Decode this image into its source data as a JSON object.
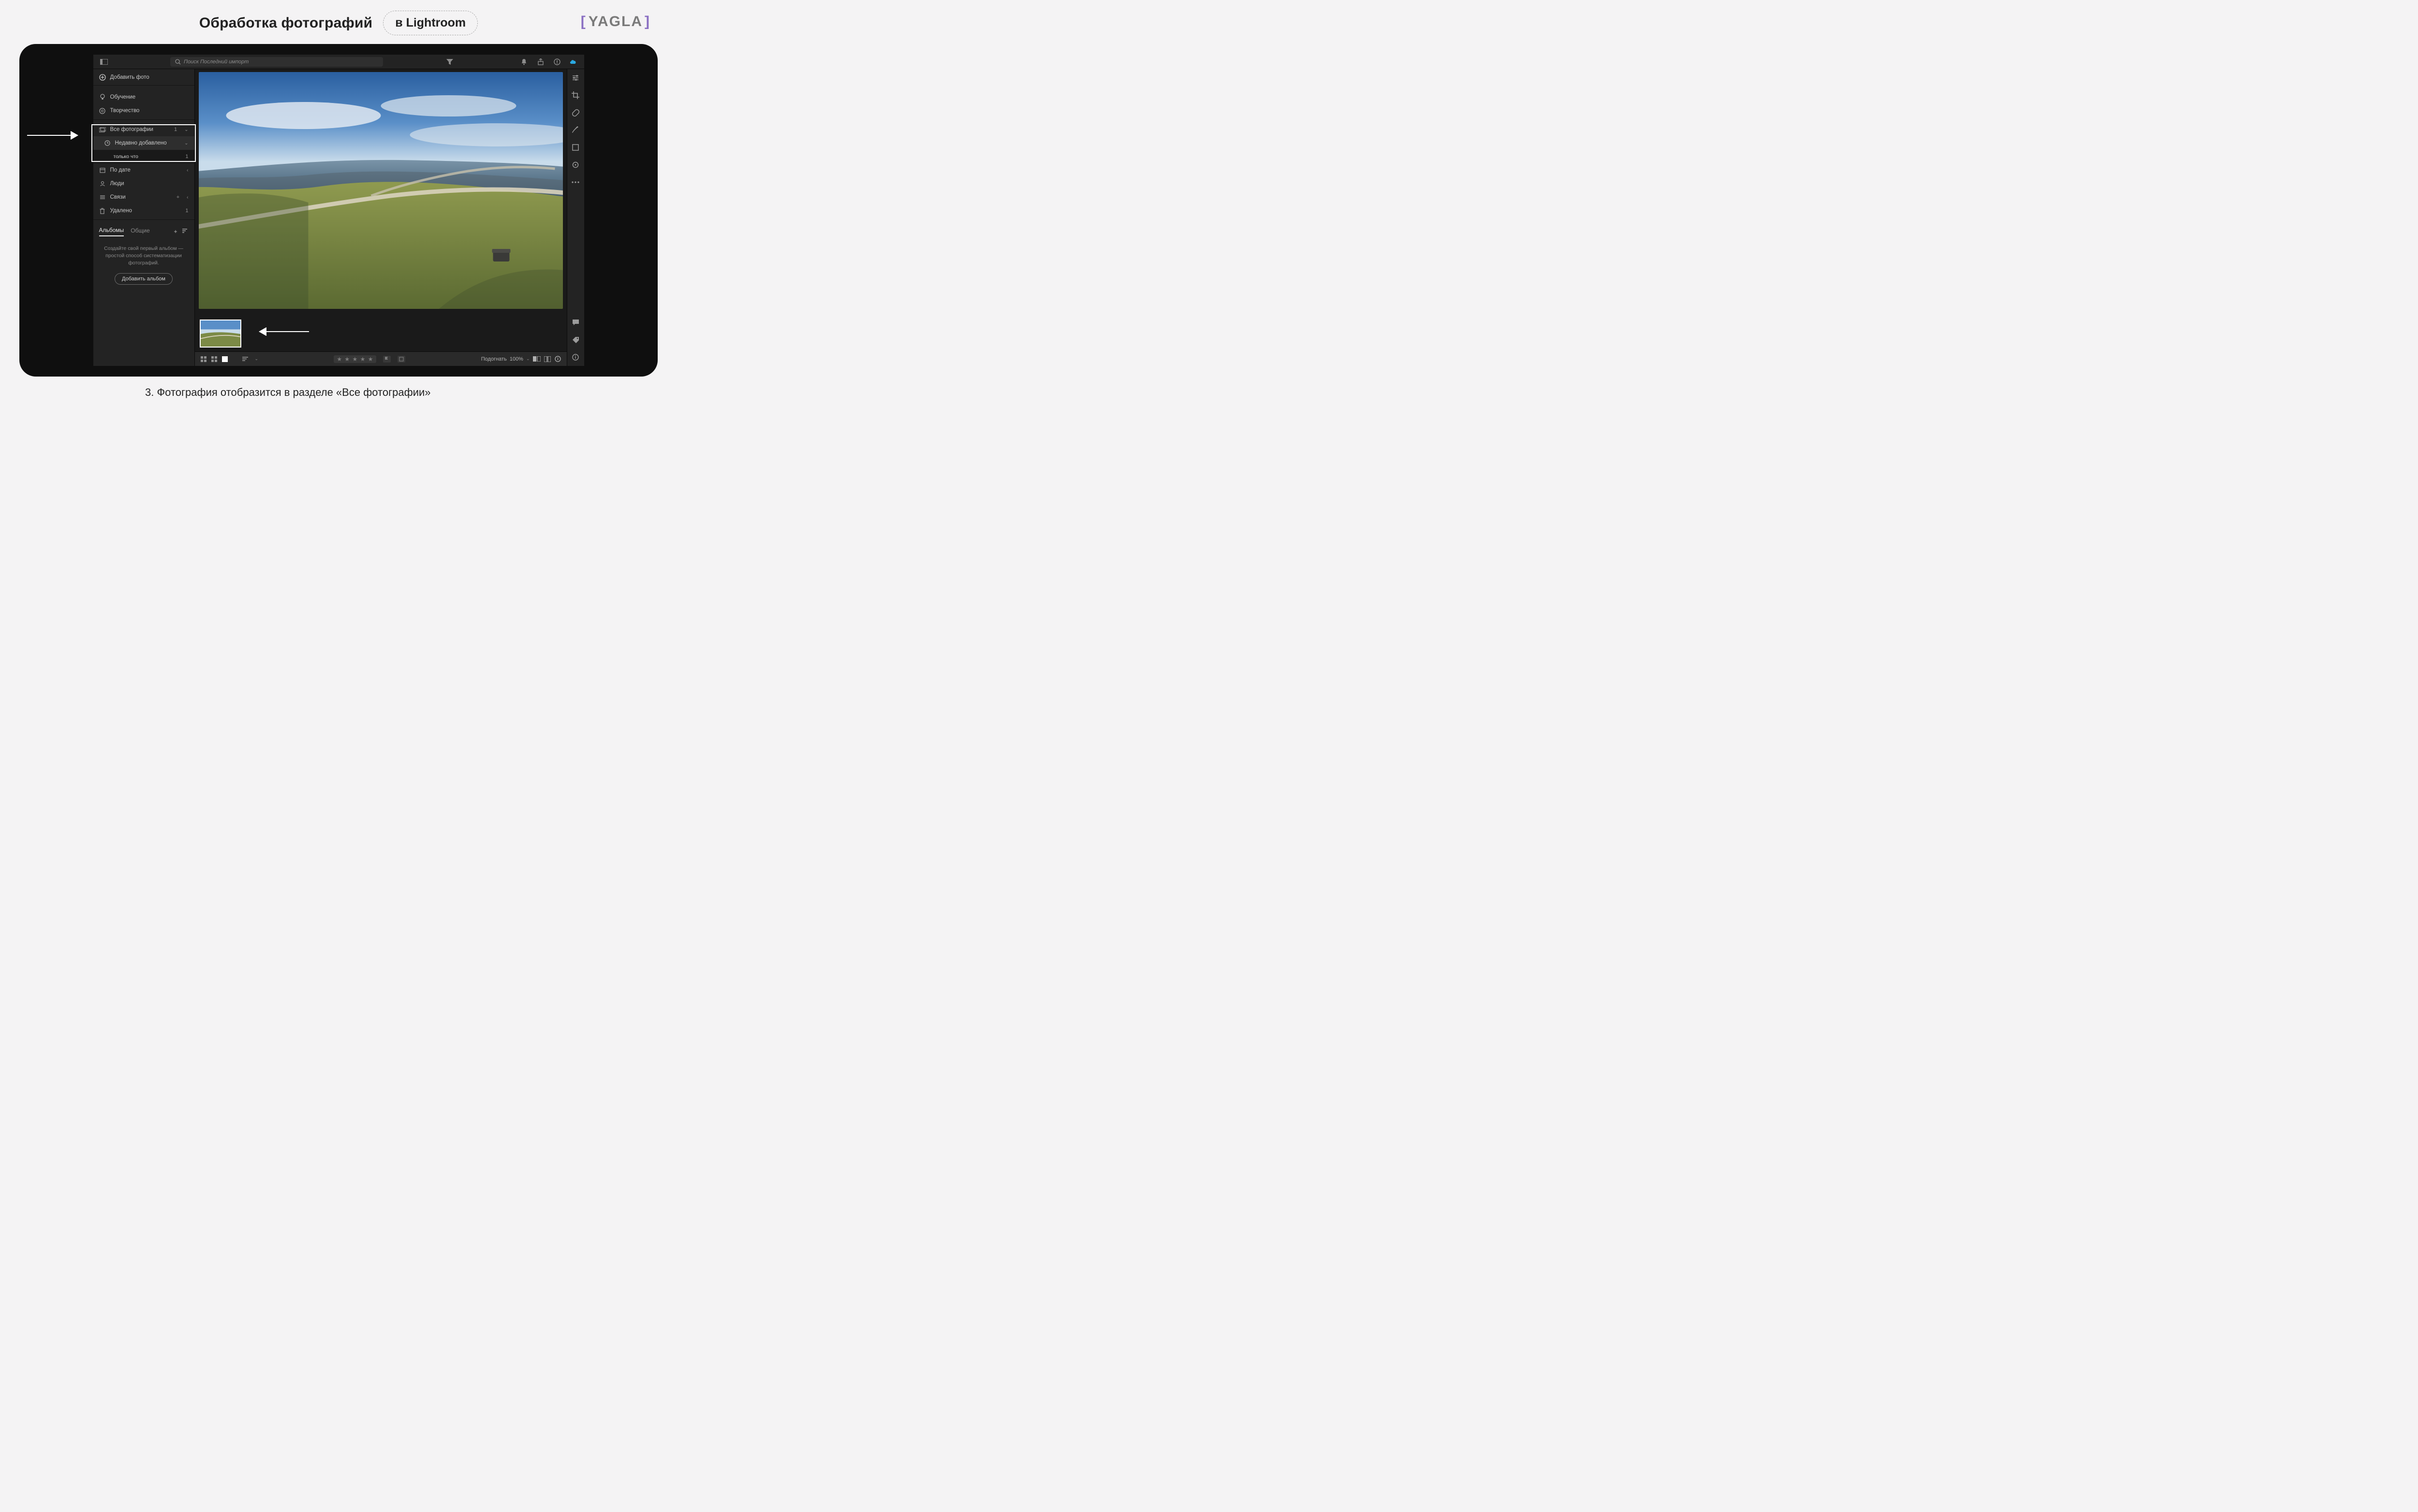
{
  "page": {
    "title": "Обработка фотографий",
    "pill": "в Lightroom",
    "brand": "YAGLA",
    "caption": "3. Фотография отобразится в разделе «Все фотографии»"
  },
  "topbar": {
    "search_placeholder": "Поиск Последний импорт"
  },
  "sidebar": {
    "add_photos": "Добавить фото",
    "learn": "Обучение",
    "creativity": "Творчество",
    "all_photos": {
      "label": "Все фотографии",
      "count": "1"
    },
    "recent": {
      "label": "Недавно добавлено"
    },
    "recent_sub": {
      "label": "только что",
      "count": "1"
    },
    "by_date": "По дате",
    "people": "Люди",
    "links": "Связи",
    "deleted": {
      "label": "Удалено",
      "count": "1"
    },
    "albums_tab": "Альбомы",
    "shared_tab": "Общие",
    "albums_empty": "Создайте свой первый альбом — простой способ систематизации фотографий.",
    "add_album": "Добавить альбом"
  },
  "bottombar": {
    "fit_label": "Подогнать",
    "zoom": "100%"
  },
  "colors": {
    "accent": "#8a6fc2",
    "cloud": "#2aa8e0"
  }
}
